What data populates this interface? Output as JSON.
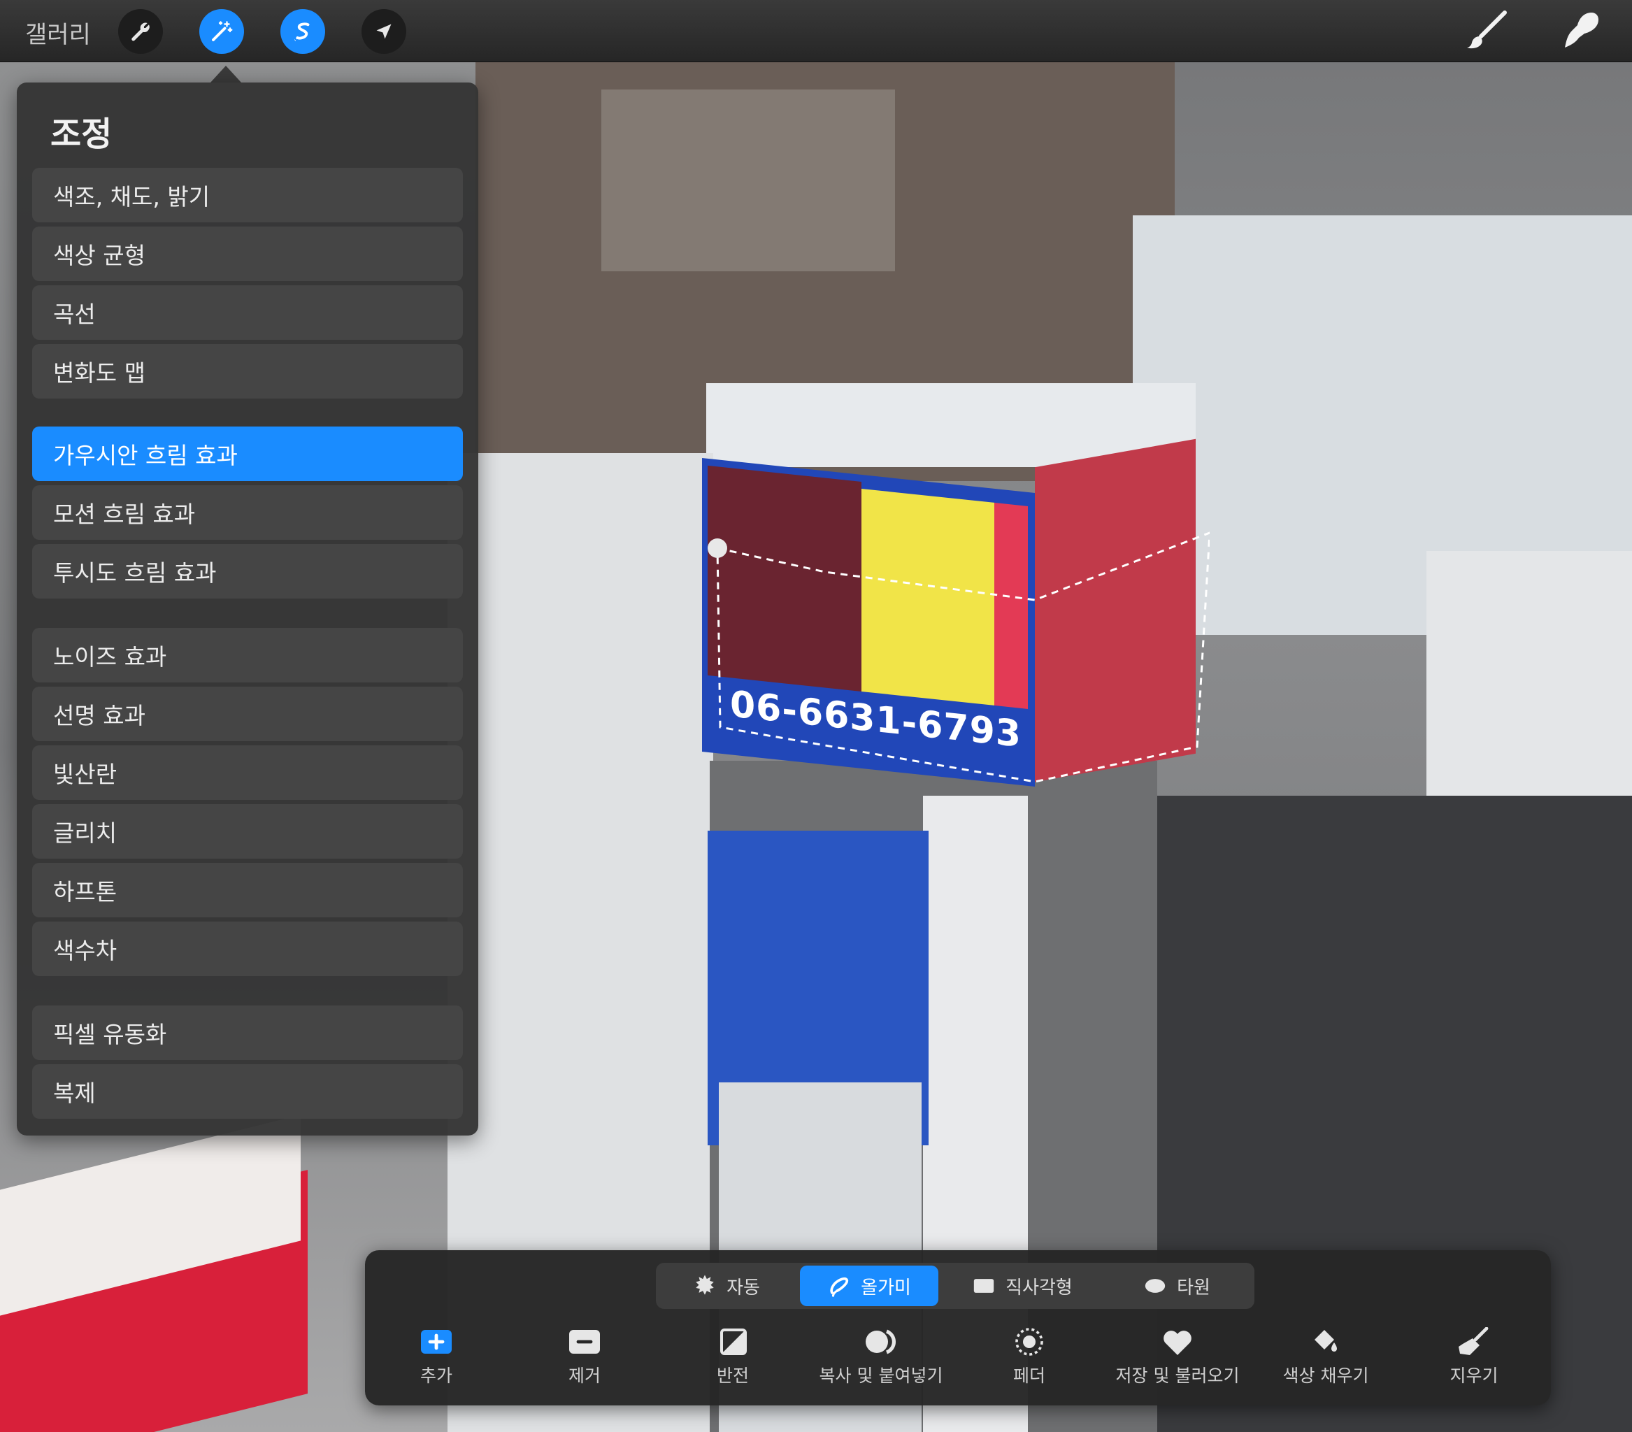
{
  "topbar": {
    "gallery_label": "갤러리",
    "left_tools": [
      {
        "icon": "wrench-icon",
        "active": false
      },
      {
        "icon": "magic-wand-icon",
        "active": true
      },
      {
        "icon": "selection-s-icon",
        "active": true
      },
      {
        "icon": "arrow-cursor-icon",
        "active": false
      }
    ],
    "right_tools": [
      {
        "icon": "brush-icon"
      },
      {
        "icon": "smudge-icon"
      }
    ]
  },
  "adjustments": {
    "title": "조정",
    "groups": [
      [
        "색조, 채도, 밝기",
        "색상 균형",
        "곡선",
        "변화도 맵"
      ],
      [
        "가우시안 흐림 효과",
        "모션 흐림 효과",
        "투시도 흐림 효과"
      ],
      [
        "노이즈 효과",
        "선명 효과",
        "빛산란",
        "글리치",
        "하프톤",
        "색수차"
      ],
      [
        "픽셀 유동화",
        "복제"
      ]
    ],
    "items": {
      "hsb": "색조, 채도, 밝기",
      "color_balance": "색상 균형",
      "curves": "곡선",
      "gradient_map": "변화도 맵",
      "gaussian_blur": "가우시안 흐림 효과",
      "motion_blur": "모션 흐림 효과",
      "perspective_blur": "투시도 흐림 효과",
      "noise": "노이즈 효과",
      "sharpen": "선명 효과",
      "bloom": "빛산란",
      "glitch": "글리치",
      "halftone": "하프톤",
      "chromatic_aberration": "색수차",
      "liquify": "픽셀 유동화",
      "clone": "복제"
    },
    "selected": "가우시안 흐림 효과"
  },
  "canvas": {
    "sign_text": "06-6631-6793"
  },
  "selection_toolbar": {
    "modes": {
      "auto": "자동",
      "freehand": "올가미",
      "rectangle": "직사각형",
      "ellipse": "타원"
    },
    "selected_mode": "올가미",
    "actions": {
      "add": "추가",
      "remove": "제거",
      "invert": "반전",
      "copy_paste": "복사 및 붙여넣기",
      "feather": "페더",
      "save_load": "저장 및 불러오기",
      "color_fill": "색상 채우기",
      "clear": "지우기"
    }
  },
  "colors": {
    "accent": "#1a8cff",
    "panel": "#343434",
    "panel_item": "#454545"
  }
}
